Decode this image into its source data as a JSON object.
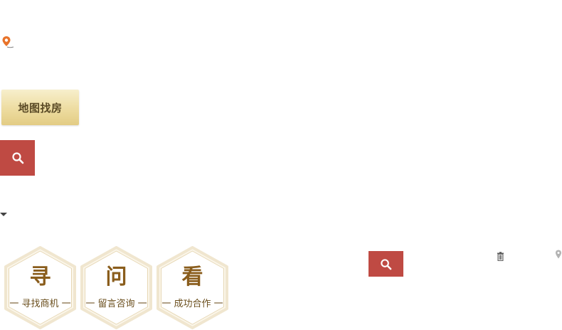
{
  "location": {
    "icon": "map-pin-icon"
  },
  "map_search": {
    "label": "地图找房"
  },
  "search": {
    "icon": "search-icon"
  },
  "dropdown": {
    "icon": "caret-down-icon"
  },
  "cards": [
    {
      "glyph": "寻",
      "label": "一 寻找商机 一"
    },
    {
      "glyph": "问",
      "label": "一 留言咨询 一"
    },
    {
      "glyph": "看",
      "label": "一 成功合作 一"
    }
  ],
  "toolbar": {
    "search_icon": "search-icon",
    "delete_icon": "trash-icon",
    "locate_icon": "map-pin-icon"
  },
  "colors": {
    "accent_red": "#bf4a43",
    "gold_button": "#eddca0",
    "hex_brown": "#8a5d1c",
    "pin_orange": "#e8732a"
  }
}
